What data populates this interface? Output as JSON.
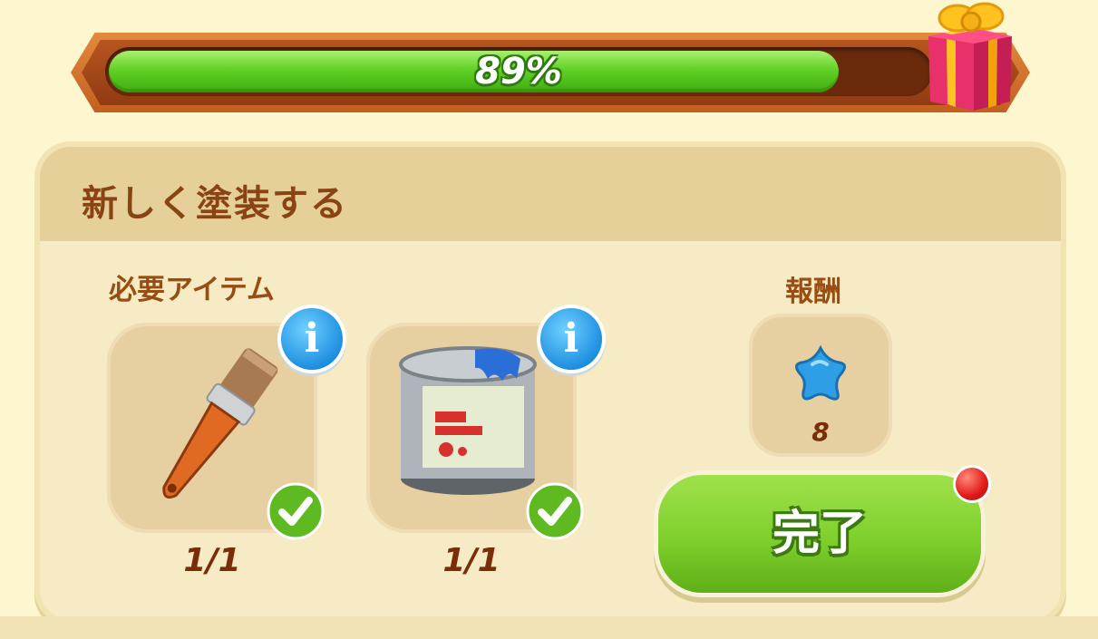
{
  "progress": {
    "value_percent": 89,
    "label": "89%"
  },
  "task": {
    "title": "新しく塗装する"
  },
  "required_items": {
    "label": "必要アイテム",
    "items": [
      {
        "icon": "paintbrush-icon",
        "count": "1/1",
        "complete": true
      },
      {
        "icon": "paint-can-icon",
        "count": "1/1",
        "complete": true
      }
    ]
  },
  "reward": {
    "label": "報酬",
    "icon": "blue-star-icon",
    "amount": "8"
  },
  "complete_button": {
    "label": "完了"
  },
  "colors": {
    "progress_fill": "#62d125",
    "frame": "#c35f1f",
    "panel": "#f6ebc4",
    "accent_text": "#9a4d12",
    "button": "#7fcf2c",
    "info": "#1f8fe0",
    "notification": "#e21a1a"
  }
}
